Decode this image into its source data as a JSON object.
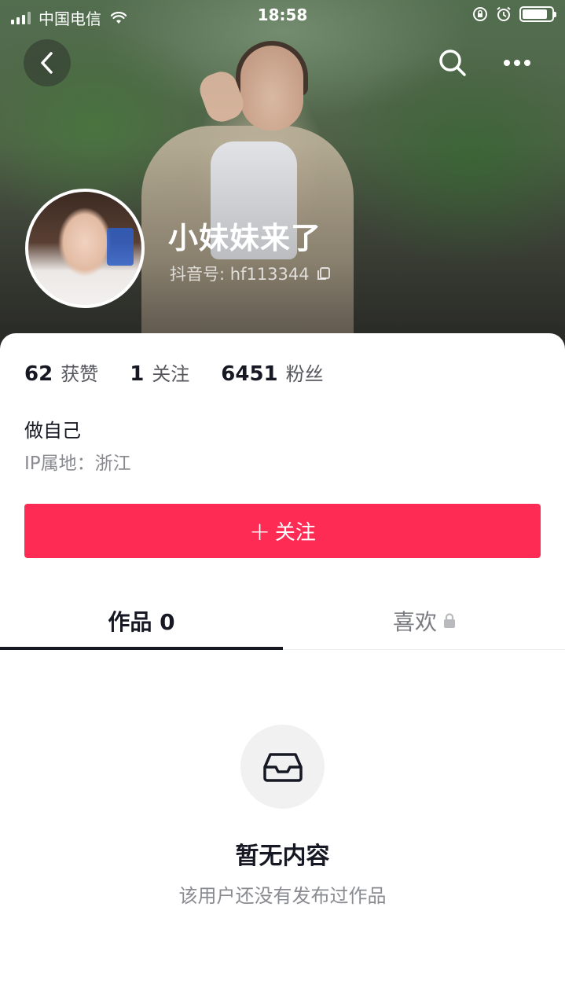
{
  "status_bar": {
    "carrier": "中国电信",
    "time": "18:58",
    "battery_level": 0.85
  },
  "nav": {
    "back_icon": "chevron-left-icon",
    "search_icon": "search-icon",
    "more_icon": "more-horizontal-icon"
  },
  "profile": {
    "name": "小妹妹来了",
    "douyin_id_label": "抖音号: hf113344"
  },
  "stats": [
    {
      "value": "62",
      "label": "获赞"
    },
    {
      "value": "1",
      "label": "关注"
    },
    {
      "value": "6451",
      "label": "粉丝"
    }
  ],
  "bio": "做自己",
  "ip_location": "IP属地：浙江",
  "follow_button": {
    "plus": "+",
    "label": "关注"
  },
  "tabs": [
    {
      "label": "作品 0",
      "active": true
    },
    {
      "label": "喜欢",
      "locked": true
    }
  ],
  "empty_state": {
    "title": "暂无内容",
    "subtitle": "该用户还没有发布过作品"
  },
  "colors": {
    "accent": "#fe2c55",
    "text_primary": "#161823",
    "text_secondary": "#8a8b91"
  }
}
